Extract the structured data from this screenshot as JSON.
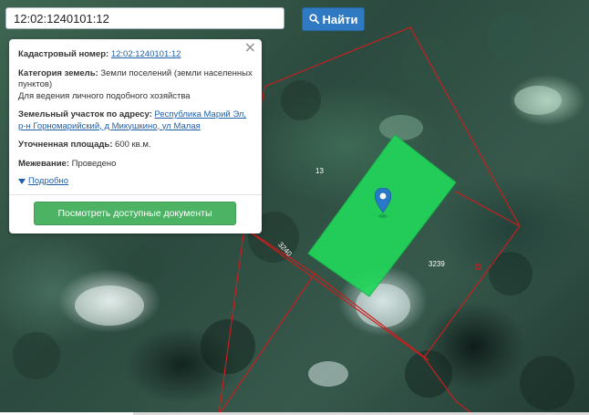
{
  "search": {
    "value": "12:02:1240101:12",
    "button_label": "Найти"
  },
  "popup": {
    "cadastral_label": "Кадастровый номер:",
    "cadastral_value": "12:02:1240101:12",
    "category_label": "Категория земель:",
    "category_value": "Земли поселений (земли населенных пунктов)",
    "use_value": "Для ведения личного подобного хозяйства",
    "address_label": "Земельный участок по адресу:",
    "address_value": "Республика Марий Эл, р-н Горномарийский, д Микушкино, ул Малая",
    "area_label": "Уточненная площадь:",
    "area_value": "600 кв.м.",
    "survey_label": "Межевание:",
    "survey_value": "Проведено",
    "more_label": "Подробно",
    "docs_button_label": "Посмотреть доступные документы"
  },
  "map": {
    "plot_labels": [
      "13",
      "3240",
      "3239"
    ],
    "plot_color": "#22d65a",
    "boundary_color": "#c81e1e",
    "pin_color": "#2a79c9"
  }
}
